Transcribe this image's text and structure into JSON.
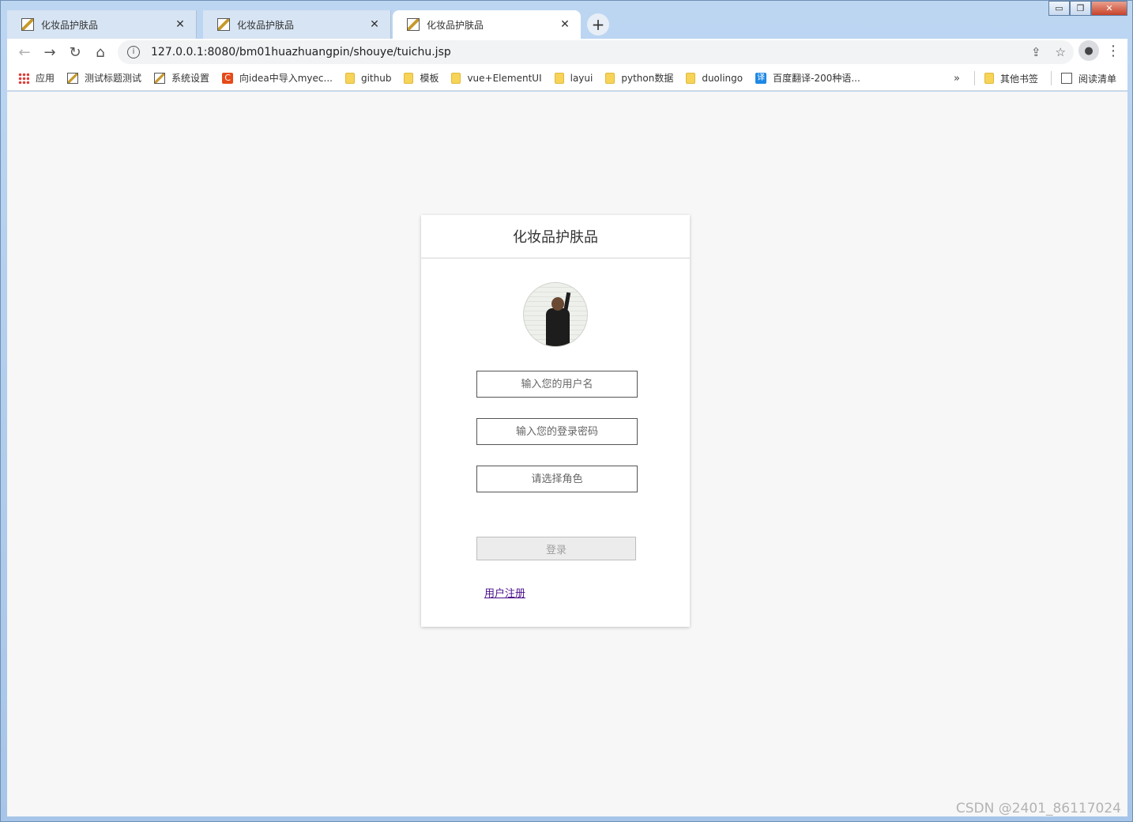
{
  "window_controls": {
    "minimize": "▭",
    "maximize": "❐",
    "close": "✕"
  },
  "tabs": [
    {
      "title": "化妆品护肤品",
      "close": "✕"
    },
    {
      "title": "化妆品护肤品",
      "close": "✕"
    },
    {
      "title": "化妆品护肤品",
      "close": "✕"
    }
  ],
  "new_tab": "+",
  "toolbar": {
    "back": "←",
    "forward": "→",
    "reload": "↻",
    "home": "⌂",
    "url": "127.0.0.1:8080/bm01huazhuangpin/shouye/tuichu.jsp",
    "info": "i",
    "share": "⇪",
    "star": "☆",
    "profile": "●",
    "menu": "⋮"
  },
  "bookmarks": {
    "items": [
      {
        "label": "应用",
        "icon": "apps-icon"
      },
      {
        "label": "测试标题测试",
        "icon": "page-icon"
      },
      {
        "label": "系统设置",
        "icon": "page-icon"
      },
      {
        "label": "向idea中导入myec...",
        "icon": "c-icon"
      },
      {
        "label": "github",
        "icon": "folder-icon"
      },
      {
        "label": "模板",
        "icon": "folder-icon"
      },
      {
        "label": "vue+ElementUI",
        "icon": "folder-icon"
      },
      {
        "label": "layui",
        "icon": "folder-icon"
      },
      {
        "label": "python数据",
        "icon": "folder-icon"
      },
      {
        "label": "duolingo",
        "icon": "folder-icon"
      },
      {
        "label": "百度翻译-200种语...",
        "icon": "translate-icon"
      }
    ],
    "more": "»",
    "other": "其他书签",
    "reading_list": "阅读清单",
    "c_glyph": "C",
    "translate_glyph": "译"
  },
  "login": {
    "title": "化妆品护肤品",
    "username_placeholder": "输入您的用户名",
    "password_placeholder": "输入您的登录密码",
    "role_placeholder": "请选择角色",
    "login_label": "登录",
    "register_label": "用户注册"
  },
  "watermark": "CSDN @2401_86117024"
}
